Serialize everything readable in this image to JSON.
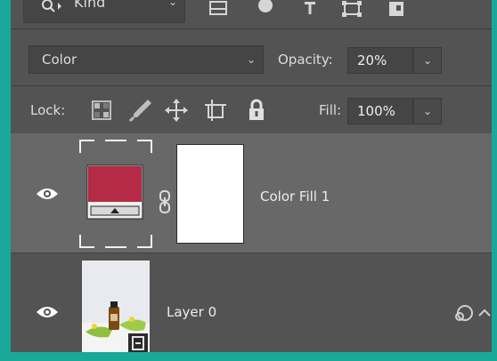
{
  "filter": {
    "kind_label": "Kind",
    "icons": [
      "image-filter-icon",
      "adjustment-filter-icon",
      "type-filter-icon",
      "shape-filter-icon",
      "smart-object-filter-icon"
    ]
  },
  "blend": {
    "mode": "Color",
    "opacity_label": "Opacity:",
    "opacity_value": "20%"
  },
  "lock": {
    "label": "Lock:",
    "fill_label": "Fill:",
    "fill_value": "100%"
  },
  "layers": [
    {
      "name": "Color Fill 1",
      "visible": true,
      "fill_color": "#b52a45"
    },
    {
      "name": "Layer 0",
      "visible": true
    }
  ],
  "colors": {
    "panel_bg": "#535353",
    "selected_layer_bg": "#686868",
    "frame": "#1aa89a"
  }
}
